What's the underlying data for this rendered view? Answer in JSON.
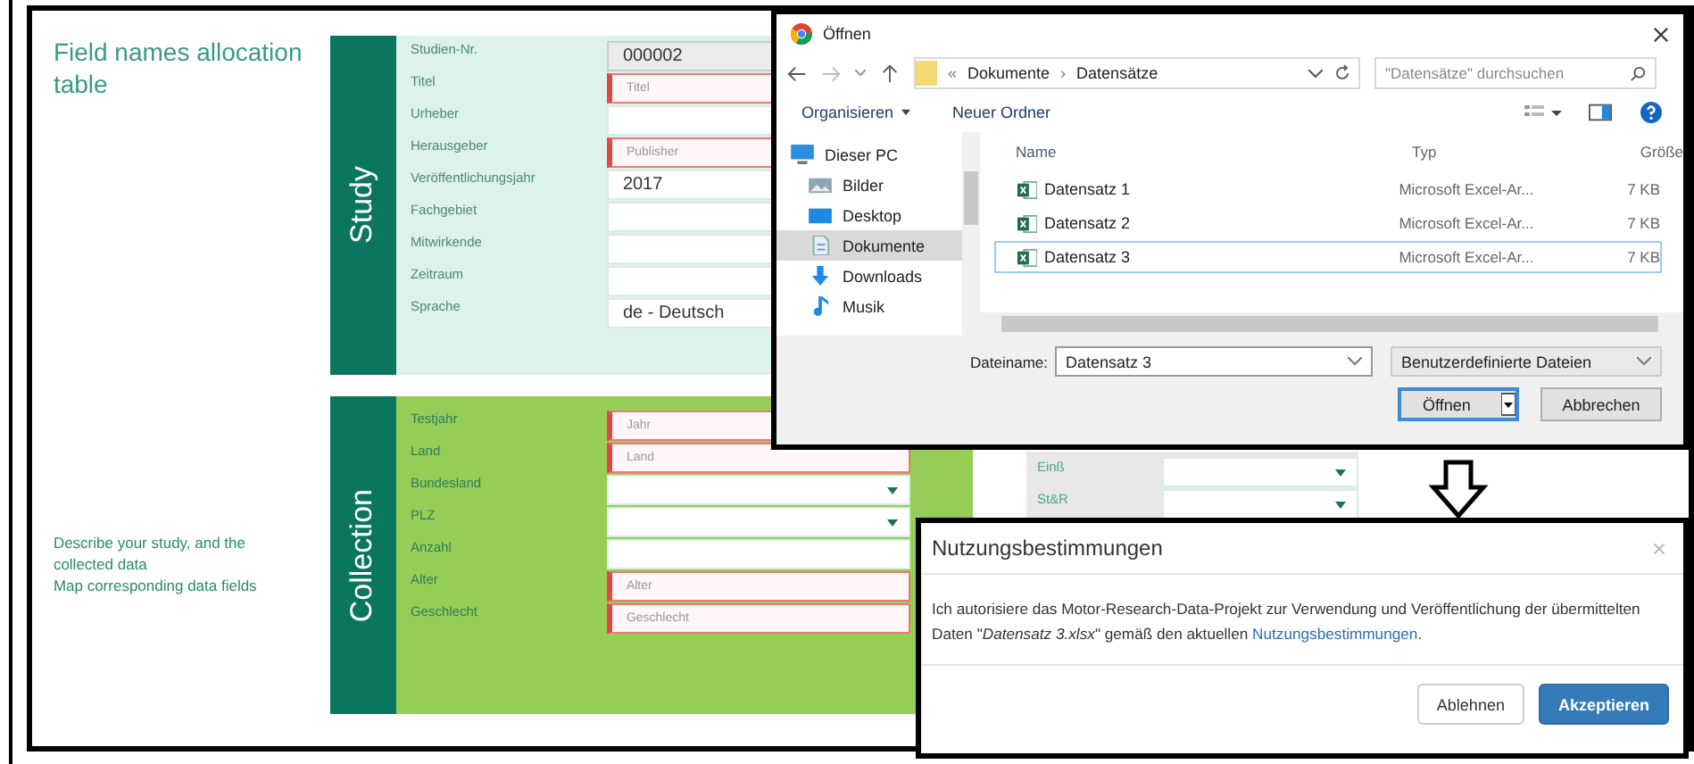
{
  "page": {
    "title": "Field names allocation table",
    "description": [
      "Describe your study, and the collected data",
      "Map corresponding data fields"
    ]
  },
  "sections": [
    {
      "title": "Study",
      "kind": "study",
      "fields": [
        {
          "label": "Studien-Nr.",
          "kind": "readonly",
          "value": "000002",
          "required": false
        },
        {
          "label": "Titel",
          "kind": "input",
          "placeholder": "Titel",
          "required": true
        },
        {
          "label": "Urheber",
          "kind": "input",
          "required": false
        },
        {
          "label": "Herausgeber",
          "kind": "input",
          "placeholder": "Publisher",
          "required": true
        },
        {
          "label": "Veröffentlichungsjahr",
          "kind": "input",
          "value": "2017",
          "required": false
        },
        {
          "label": "Fachgebiet",
          "kind": "input",
          "required": false
        },
        {
          "label": "Mitwirkende",
          "kind": "input",
          "required": false
        },
        {
          "label": "Zeitraum",
          "kind": "input",
          "required": false
        },
        {
          "label": "Sprache",
          "kind": "input",
          "value": "de - Deutsch",
          "required": false
        }
      ]
    },
    {
      "title": "Collection",
      "kind": "collection",
      "fields": [
        {
          "label": "Testjahr",
          "kind": "input",
          "placeholder": "Jahr",
          "required": true
        },
        {
          "label": "Land",
          "kind": "input",
          "placeholder": "Land",
          "required": true
        },
        {
          "label": "Bundesland",
          "kind": "select",
          "required": false
        },
        {
          "label": "PLZ",
          "kind": "select",
          "required": false
        },
        {
          "label": "Anzahl",
          "kind": "input",
          "required": false
        },
        {
          "label": "Alter",
          "kind": "input",
          "placeholder": "Alter",
          "required": true
        },
        {
          "label": "Geschlecht",
          "kind": "input",
          "placeholder": "Geschlecht",
          "required": true
        }
      ]
    }
  ],
  "mapping": {
    "fields": [
      {
        "label": "Einß",
        "kind": "select"
      },
      {
        "label": "St&R",
        "kind": "select"
      }
    ]
  },
  "file_dialog": {
    "title": "Öffnen",
    "address": [
      "«",
      "Dokumente",
      "›",
      "Datensätze"
    ],
    "search": {
      "placeholder": "\"Datensätze\" durchsuchen"
    },
    "toolbar": [
      {
        "label": "Organisieren",
        "kind": "menu"
      },
      {
        "label": "Neuer Ordner",
        "kind": "button"
      }
    ],
    "sidebar": [
      {
        "label": "Dieser PC",
        "kind": "pc",
        "selected": false,
        "children": [
          {
            "label": "Bilder",
            "kind": "pictures",
            "selected": false
          },
          {
            "label": "Desktop",
            "kind": "desktop",
            "selected": false
          },
          {
            "label": "Dokumente",
            "kind": "documents",
            "selected": true
          },
          {
            "label": "Downloads",
            "kind": "downloads",
            "selected": false
          },
          {
            "label": "Musik",
            "kind": "music",
            "selected": false
          }
        ]
      }
    ],
    "columns": [
      "Name",
      "Typ",
      "Größe"
    ],
    "files": [
      {
        "name": "Datensatz 1",
        "type": "Microsoft Excel-Ar...",
        "size": "7 KB",
        "selected": false
      },
      {
        "name": "Datensatz 2",
        "type": "Microsoft Excel-Ar...",
        "size": "7 KB",
        "selected": false
      },
      {
        "name": "Datensatz 3",
        "type": "Microsoft Excel-Ar...",
        "size": "7 KB",
        "selected": true
      }
    ],
    "filename": {
      "label": "Dateiname:",
      "value": "Datensatz 3"
    },
    "filter": "Benutzerdefinierte Dateien",
    "buttons": [
      {
        "label": "Öffnen",
        "kind": "split"
      },
      {
        "label": "Abbrechen",
        "kind": "default"
      }
    ]
  },
  "terms_dialog": {
    "title": "Nutzungsbestimmungen",
    "text": "Ich autorisiere das Motor-Research-Data-Projekt zur Verwendung und Veröffentlichung der übermittelten Daten \"*Datensatz 3.xlsx*\" gemäß den aktuellen ",
    "link": "Nutzungsbestimmungen",
    "text_end": ".",
    "buttons": [
      {
        "label": "Ablehnen",
        "kind": "default"
      },
      {
        "label": "Akzeptieren",
        "kind": "primary"
      }
    ]
  }
}
